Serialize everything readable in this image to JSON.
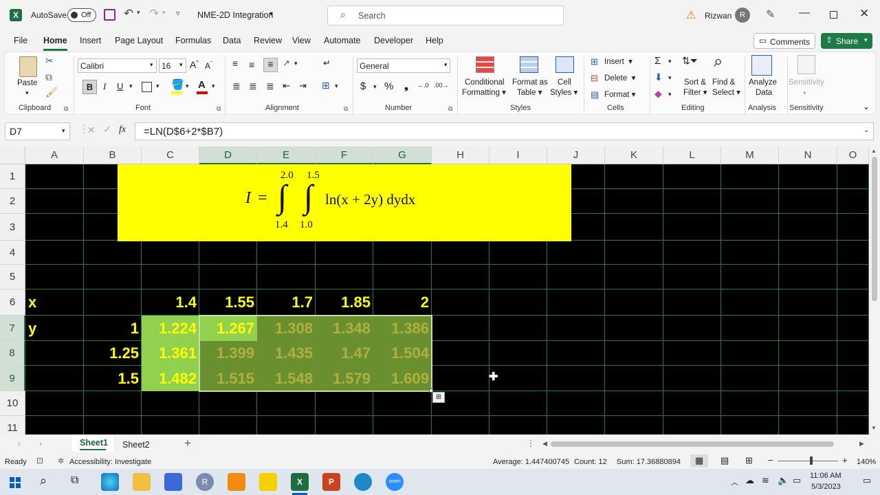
{
  "titlebar": {
    "autosave_label": "AutoSave",
    "autosave_state": "Off",
    "filename": "NME-2D Integration",
    "search_placeholder": "Search",
    "user_name": "Rizwan",
    "user_initial": "R"
  },
  "menu": {
    "items": [
      "File",
      "Home",
      "Insert",
      "Page Layout",
      "Formulas",
      "Data",
      "Review",
      "View",
      "Automate",
      "Developer",
      "Help"
    ],
    "active": "Home",
    "comments_label": "Comments",
    "share_label": "Share"
  },
  "ribbon": {
    "clipboard": {
      "label": "Clipboard",
      "paste": "Paste"
    },
    "font": {
      "label": "Font",
      "name": "Calibri",
      "size": "16"
    },
    "alignment": {
      "label": "Alignment"
    },
    "number": {
      "label": "Number",
      "format": "General"
    },
    "styles": {
      "label": "Styles",
      "conditional_1": "Conditional",
      "conditional_2": "Formatting",
      "format_as_1": "Format as",
      "format_as_2": "Table",
      "cell_styles_1": "Cell",
      "cell_styles_2": "Styles"
    },
    "cells": {
      "label": "Cells",
      "insert": "Insert",
      "delete": "Delete",
      "format": "Format"
    },
    "editing": {
      "label": "Editing",
      "sort_1": "Sort &",
      "sort_2": "Filter",
      "find_1": "Find &",
      "find_2": "Select"
    },
    "analysis": {
      "label": "Analysis",
      "analyze_1": "Analyze",
      "analyze_2": "Data"
    },
    "sensitivity": {
      "label": "Sensitivity",
      "button": "Sensitivity"
    }
  },
  "formula_bar": {
    "name_box": "D7",
    "fx": "fx",
    "formula": "=LN(D$6+2*$B7)"
  },
  "grid": {
    "columns": [
      "A",
      "B",
      "C",
      "D",
      "E",
      "F",
      "G",
      "H",
      "I",
      "J",
      "K",
      "L",
      "M",
      "N",
      "O"
    ],
    "selected_columns": [
      "D",
      "E",
      "F",
      "G"
    ],
    "rows": [
      "1",
      "2",
      "3",
      "4",
      "5",
      "6",
      "7",
      "8",
      "9",
      "10",
      "11"
    ],
    "selected_rows": [
      "7",
      "8",
      "9"
    ],
    "equation": {
      "lhs": "I",
      "eq": "=",
      "outer_upper": "2.0",
      "outer_lower": "1.4",
      "inner_upper": "1.5",
      "inner_lower": "1.0",
      "integrand": "ln(x + 2y) dydx"
    },
    "row6": {
      "label": "x",
      "values": [
        "1.4",
        "1.55",
        "1.7",
        "1.85",
        "2"
      ]
    },
    "row7": {
      "label": "y",
      "b": "1",
      "values": [
        "1.224",
        "1.267",
        "1.308",
        "1.348",
        "1.386"
      ]
    },
    "row8": {
      "b": "1.25",
      "values": [
        "1.361",
        "1.399",
        "1.435",
        "1.47",
        "1.504"
      ]
    },
    "row9": {
      "b": "1.5",
      "values": [
        "1.482",
        "1.515",
        "1.548",
        "1.579",
        "1.609"
      ]
    }
  },
  "sheets": {
    "tabs": [
      "Sheet1",
      "Sheet2"
    ],
    "active": "Sheet1",
    "add": "+"
  },
  "status": {
    "ready": "Ready",
    "accessibility": "Accessibility: Investigate",
    "average": "Average: 1.447400745",
    "count": "Count: 12",
    "sum": "Sum: 17.36880894",
    "zoom": "140%"
  },
  "taskbar": {
    "time": "11:06 AM",
    "date": "5/3/2023"
  },
  "colors": {
    "excel_green": "#217346",
    "cell_yellow": "#ffff00",
    "equation_bg": "#ffff00",
    "fill_light": "#92d050",
    "fill_dark": "#6a8f2e"
  }
}
